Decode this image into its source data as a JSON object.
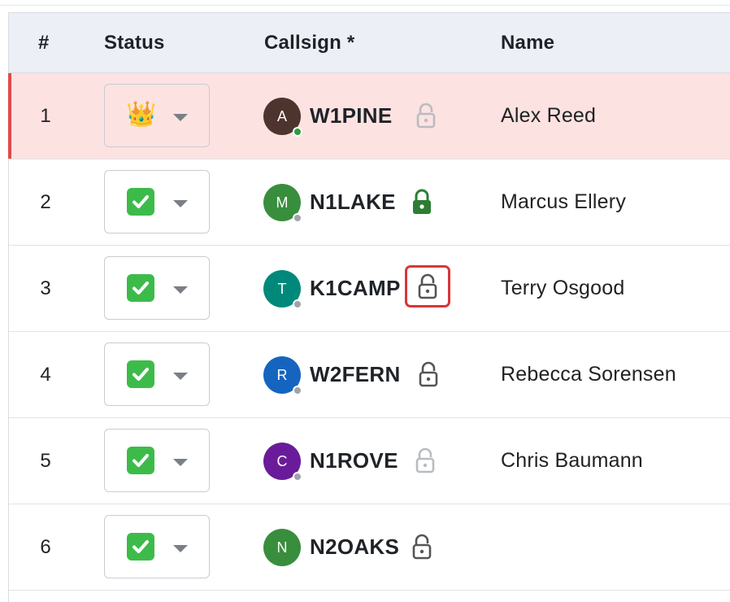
{
  "columns": {
    "num": "#",
    "status": "Status",
    "callsign": "Callsign *",
    "name": "Name"
  },
  "colors": {
    "active_row_bg": "#fde2e2",
    "active_row_accent": "#e14b4b",
    "header_bg": "#eceff5",
    "lock_highlight": "#d93636"
  },
  "rows": [
    {
      "num": "1",
      "status_icon": "crown-icon",
      "status_glyph": "👑",
      "avatar_letter": "A",
      "avatar_color": "#4e342e",
      "presence_color": "#2e9d3a",
      "callsign": "W1PINE",
      "lock_icon": "unlocked-icon",
      "lock_state": "faint",
      "name": "Alex Reed",
      "active": true
    },
    {
      "num": "2",
      "status_icon": "check-box-icon",
      "avatar_letter": "M",
      "avatar_color": "#388e3c",
      "presence_color": "#9ea4aa",
      "callsign": "N1LAKE",
      "lock_icon": "locked-icon",
      "lock_state": "locked",
      "name": "Marcus Ellery"
    },
    {
      "num": "3",
      "status_icon": "check-box-icon",
      "avatar_letter": "T",
      "avatar_color": "#00897b",
      "presence_color": "#9ea4aa",
      "callsign": "K1CAMP",
      "lock_icon": "unlocked-icon",
      "lock_state": "highlighted",
      "name": "Terry Osgood"
    },
    {
      "num": "4",
      "status_icon": "check-box-icon",
      "avatar_letter": "R",
      "avatar_color": "#1565c0",
      "presence_color": "#9ea4aa",
      "callsign": "W2FERN",
      "lock_icon": "unlocked-icon",
      "lock_state": "dark",
      "name": "Rebecca Sorensen"
    },
    {
      "num": "5",
      "status_icon": "check-box-icon",
      "avatar_letter": "C",
      "avatar_color": "#6a1b9a",
      "presence_color": "#9ea4aa",
      "callsign": "N1ROVE",
      "lock_icon": "unlocked-icon",
      "lock_state": "faint",
      "name": "Chris Baumann"
    },
    {
      "num": "6",
      "status_icon": "check-box-icon",
      "avatar_letter": "N",
      "avatar_color": "#388e3c",
      "presence_color": null,
      "callsign": "N2OAKS",
      "lock_icon": "unlocked-icon",
      "lock_state": "dark",
      "name": ""
    }
  ]
}
